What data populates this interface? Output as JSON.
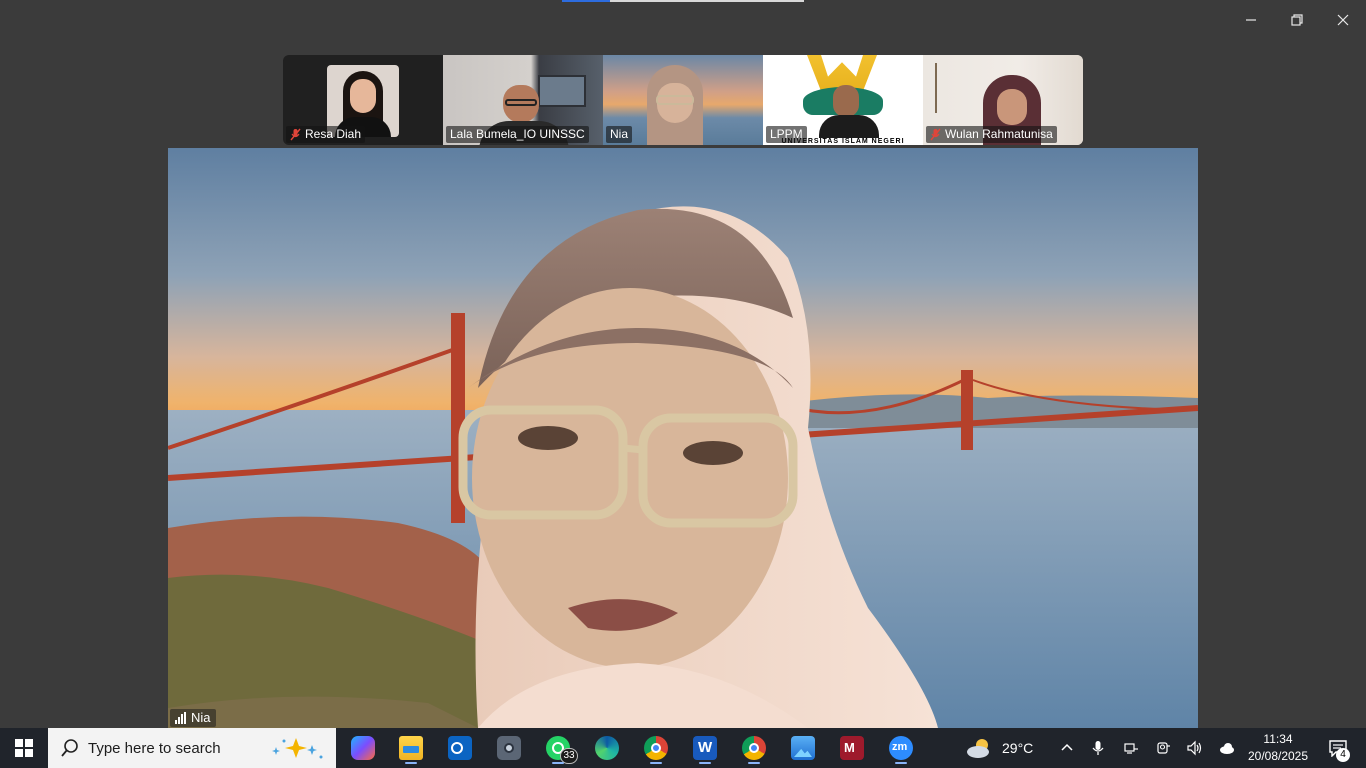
{
  "window": {
    "controls": {
      "minimize": "minimize-icon",
      "maximize": "restore-icon",
      "close": "close-icon"
    }
  },
  "participants": [
    {
      "name": "Resa Diah",
      "muted": true,
      "active": false
    },
    {
      "name": "Lala Bumela_IO UINSSC",
      "muted": false,
      "active": false
    },
    {
      "name": "Nia",
      "muted": false,
      "active": true
    },
    {
      "name": "LPPM",
      "muted": false,
      "active": false,
      "banner_text": "UNIVERSITAS ISLAM NEGERI"
    },
    {
      "name": "Wulan Rahmatunisa",
      "muted": true,
      "active": false
    }
  ],
  "main_video": {
    "speaker": "Nia",
    "background": "golden-gate-bridge-sunset",
    "colors": {
      "active_border": "#25d366",
      "bridge": "#b5412b"
    }
  },
  "taskbar": {
    "start_icon": "windows-logo-icon",
    "search_placeholder": "Type here to search",
    "apps": [
      {
        "name": "copilot",
        "icon": "copilot-icon"
      },
      {
        "name": "file-explorer",
        "icon": "folder-icon"
      },
      {
        "name": "outlook",
        "icon": "outlook-icon"
      },
      {
        "name": "camera",
        "icon": "camera-icon"
      },
      {
        "name": "whatsapp",
        "icon": "whatsapp-icon",
        "badge": "33"
      },
      {
        "name": "edge",
        "icon": "edge-icon"
      },
      {
        "name": "chrome",
        "icon": "chrome-icon"
      },
      {
        "name": "word",
        "icon": "word-icon"
      },
      {
        "name": "chrome-profile",
        "icon": "chrome-icon"
      },
      {
        "name": "photos",
        "icon": "photos-icon"
      },
      {
        "name": "mendeley",
        "icon": "mendeley-icon"
      },
      {
        "name": "zoom",
        "icon": "zoom-icon",
        "text": "zm"
      }
    ],
    "weather": {
      "temperature": "29°C",
      "icon": "partly-cloudy-icon"
    },
    "tray": [
      "chevron-up-icon",
      "microphone-icon",
      "network-icon",
      "camera-privacy-icon",
      "volume-icon",
      "onedrive-icon"
    ],
    "clock": {
      "time": "11:34",
      "date": "20/08/2025"
    },
    "notifications": {
      "count": "4"
    }
  }
}
